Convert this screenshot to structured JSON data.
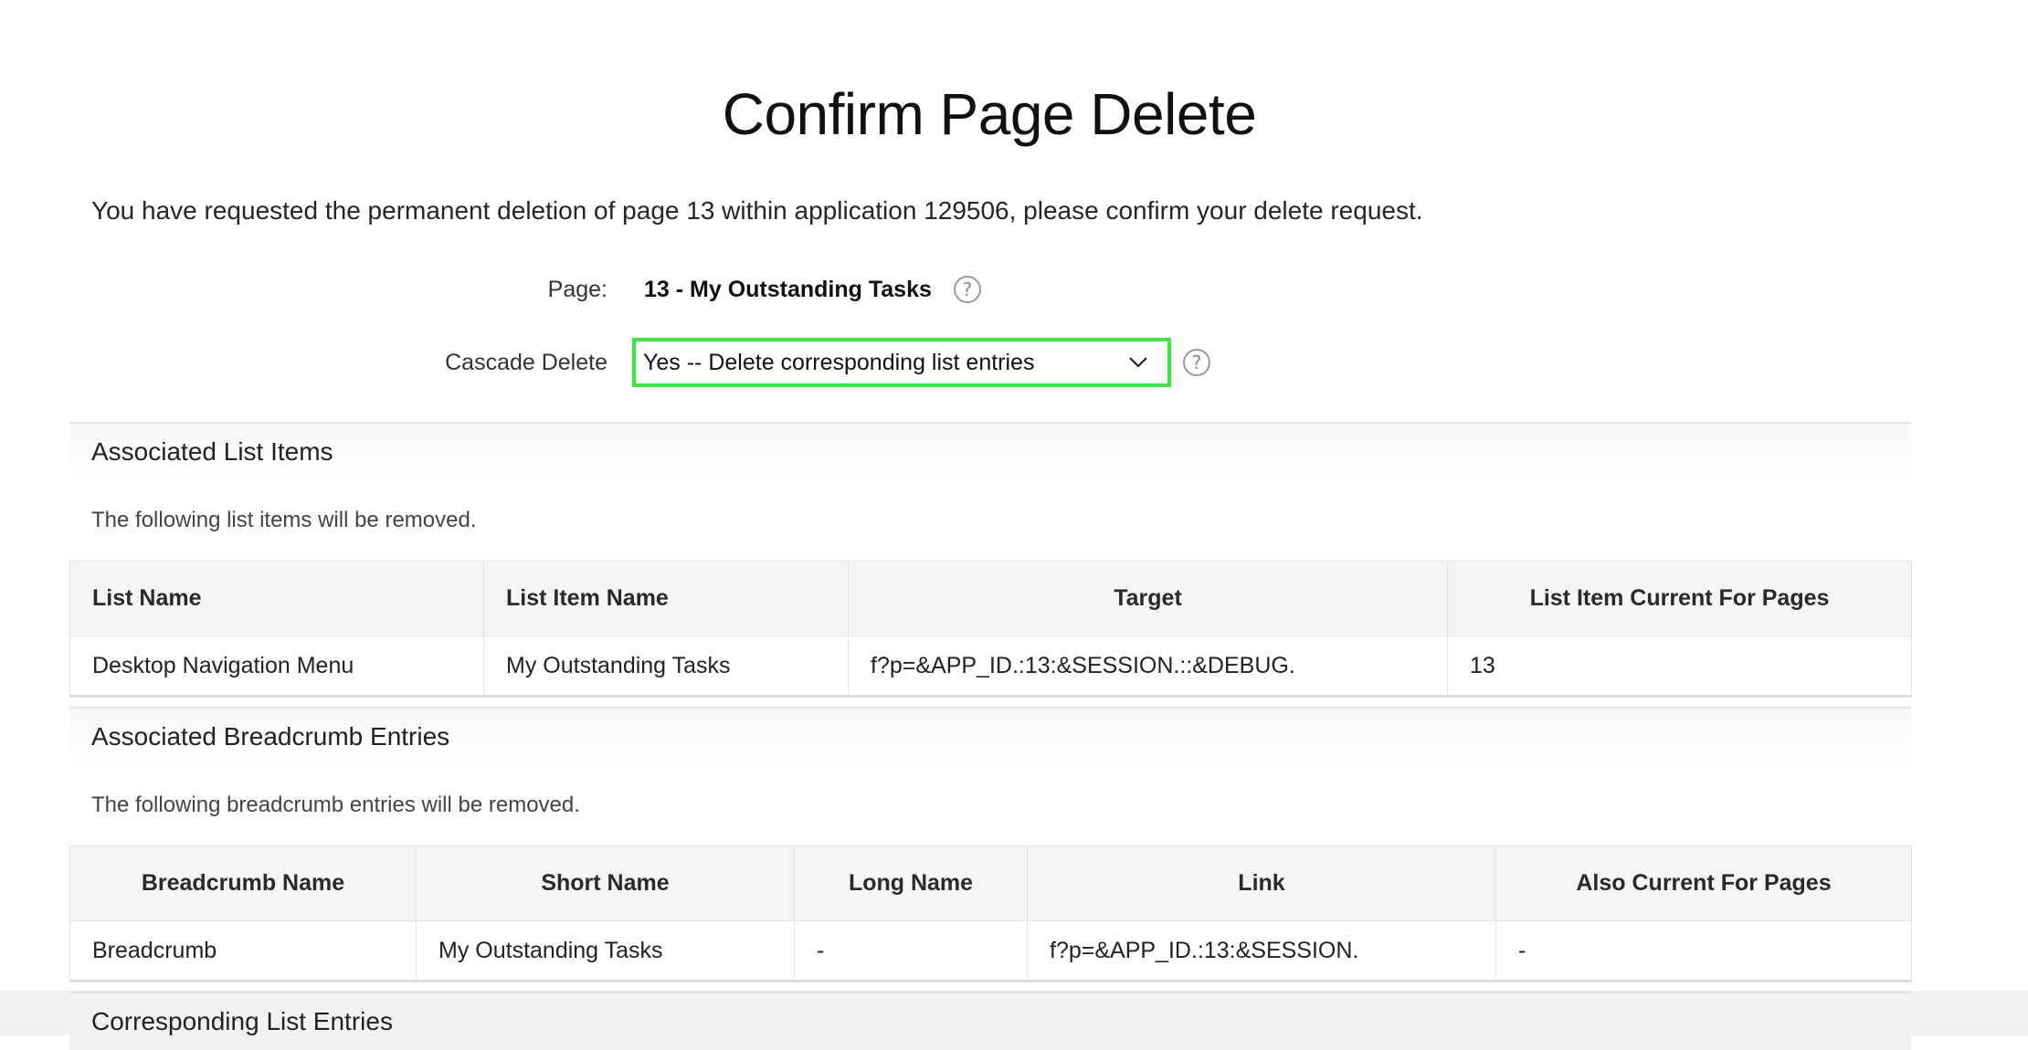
{
  "page_title": "Confirm Page Delete",
  "intro_text": "You have requested the permanent deletion of page 13 within application 129506, please confirm your delete request.",
  "form": {
    "page_label": "Page:",
    "page_value": "13 - My Outstanding Tasks",
    "cascade_label": "Cascade Delete",
    "cascade_selected": "Yes -- Delete corresponding list entries",
    "help_glyph": "?"
  },
  "list_items_section": {
    "title": "Associated List Items",
    "note": "The following list items will be removed.",
    "columns": [
      "List Name",
      "List Item Name",
      "Target",
      "List Item Current For Pages"
    ],
    "rows": [
      [
        "Desktop Navigation Menu",
        "My Outstanding Tasks",
        "f?p=&APP_ID.:13:&SESSION.::&DEBUG.",
        "13"
      ]
    ]
  },
  "breadcrumb_section": {
    "title": "Associated Breadcrumb Entries",
    "note": "The following breadcrumb entries will be removed.",
    "columns": [
      "Breadcrumb Name",
      "Short Name",
      "Long Name",
      "Link",
      "Also Current For Pages"
    ],
    "rows": [
      [
        "Breadcrumb",
        "My Outstanding Tasks",
        "-",
        "f?p=&APP_ID.:13:&SESSION.",
        "-"
      ]
    ]
  },
  "corresponding_section": {
    "title": "Corresponding List Entries"
  },
  "colors": {
    "focus_ring": "#3be83b",
    "header_bg": "#f5f5f5"
  },
  "icons": {
    "help": "help-icon",
    "select_arrow": "chevron-down-icon"
  }
}
